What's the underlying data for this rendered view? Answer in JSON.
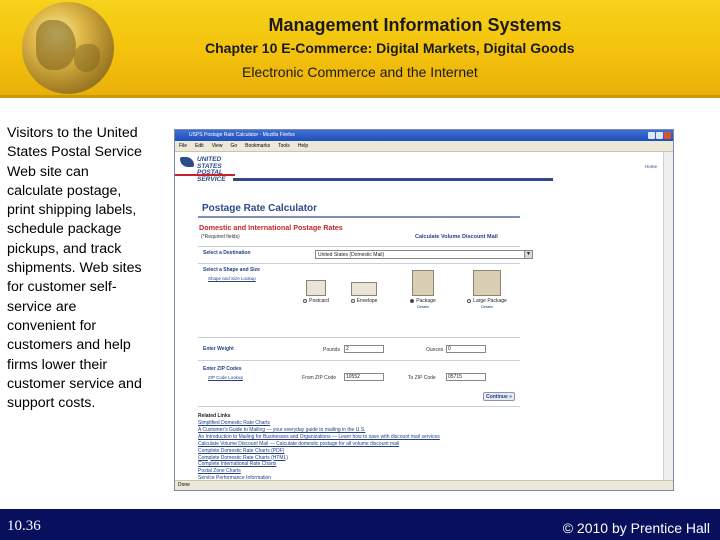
{
  "header": {
    "title": "Management Information Systems",
    "chapter": "Chapter 10 E-Commerce: Digital Markets, Digital Goods",
    "section": "Electronic Commerce and the Internet"
  },
  "body_text": "Visitors to the United States Postal Service Web site can calculate postage, print shipping labels, schedule package pickups, and track shipments. Web sites for customer self-service are convenient for customers and help firms lower their customer service and support costs.",
  "browser": {
    "window_title": "USPS Postage Rate Calculator - Mozilla Firefox",
    "menu": [
      "File",
      "Edit",
      "View",
      "Go",
      "Bookmarks",
      "Tools",
      "Help"
    ],
    "logo_line1": "UNITED STATES",
    "logo_line2": "POSTAL SERVICE",
    "help_link": "Home",
    "page_title": "Postage Rate Calculator",
    "section_title": "Domestic and International Postage Rates",
    "required_note": "(*Required fields)",
    "calc_volume_link": "Calculate Volume Discount Mail",
    "destination_label": "Select a Destination",
    "destination_value": "United States (Domestic Mail)",
    "shape_label": "Select a Shape and Size",
    "shape_sub": "Shape and Size Lookup",
    "shapes": [
      {
        "label": "Postcard",
        "selected": false,
        "detail": ""
      },
      {
        "label": "Envelope",
        "selected": false,
        "detail": ""
      },
      {
        "label": "Package",
        "selected": true,
        "detail": "Details"
      },
      {
        "label": "Large Package",
        "selected": false,
        "detail": "Details"
      }
    ],
    "weight_label": "Enter Weight",
    "pounds_label": "Pounds",
    "pounds_value": "2",
    "ounces_label": "Ounces",
    "ounces_value": "0",
    "zip_label": "Enter ZIP Codes",
    "zip_sub": "ZIP Code Lookup",
    "from_zip_label": "From ZIP Code",
    "from_zip_value": "10552",
    "to_zip_label": "To ZIP Code",
    "to_zip_value": "05715",
    "continue_label": "Continue »",
    "related_title": "Related Links",
    "related_links": [
      "Simplified Domestic Rate Charts",
      "A Customer's Guide to Mailing — your everyday guide to mailing in the U.S.",
      "An Introduction to Mailing for Businesses and Organizations — Learn how to save with discount mail services",
      "Calculate Volume Discount Mail — Calculate domestic postage for all volume discount mail",
      "Complete Domestic Rate Charts (PDF)",
      "Complete Domestic Rate Charts (HTML)",
      "Complete International Rate Charts",
      "Postal Zone Charts",
      "Service Performance Information"
    ],
    "status": "Done"
  },
  "footer": {
    "slide_number": "10.36",
    "copyright": "© 2010 by Prentice Hall"
  }
}
